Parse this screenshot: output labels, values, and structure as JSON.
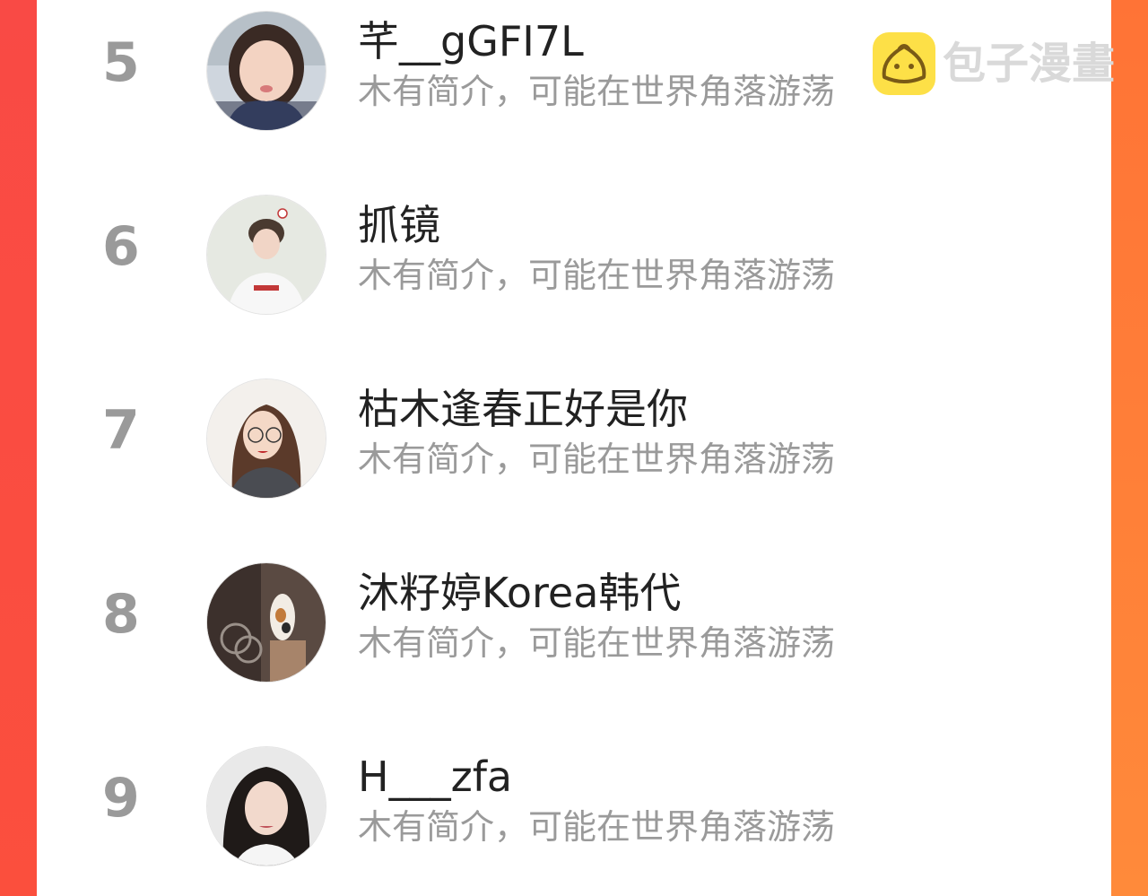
{
  "watermark": {
    "text": "包子漫畫",
    "icon": "bun-face-icon"
  },
  "rows": [
    {
      "rank": "5",
      "name": "芊__gGFI7L",
      "bio": "木有简介，可能在世界角落游荡"
    },
    {
      "rank": "6",
      "name": "抓镜",
      "bio": "木有简介，可能在世界角落游荡"
    },
    {
      "rank": "7",
      "name": "枯木逢春正好是你",
      "bio": "木有简介，可能在世界角落游荡"
    },
    {
      "rank": "8",
      "name": "沐籽婷Korea韩代",
      "bio": "木有简介，可能在世界角落游荡"
    },
    {
      "rank": "9",
      "name": "H___zfa",
      "bio": "木有简介，可能在世界角落游荡"
    }
  ],
  "colors": {
    "frame_left": "#f94a45",
    "frame_right": "#ff7a33",
    "rank_gray": "#9a9a9a",
    "name_text": "#222222",
    "bio_text": "#9a9a9a",
    "watermark_logo": "#fde047"
  }
}
